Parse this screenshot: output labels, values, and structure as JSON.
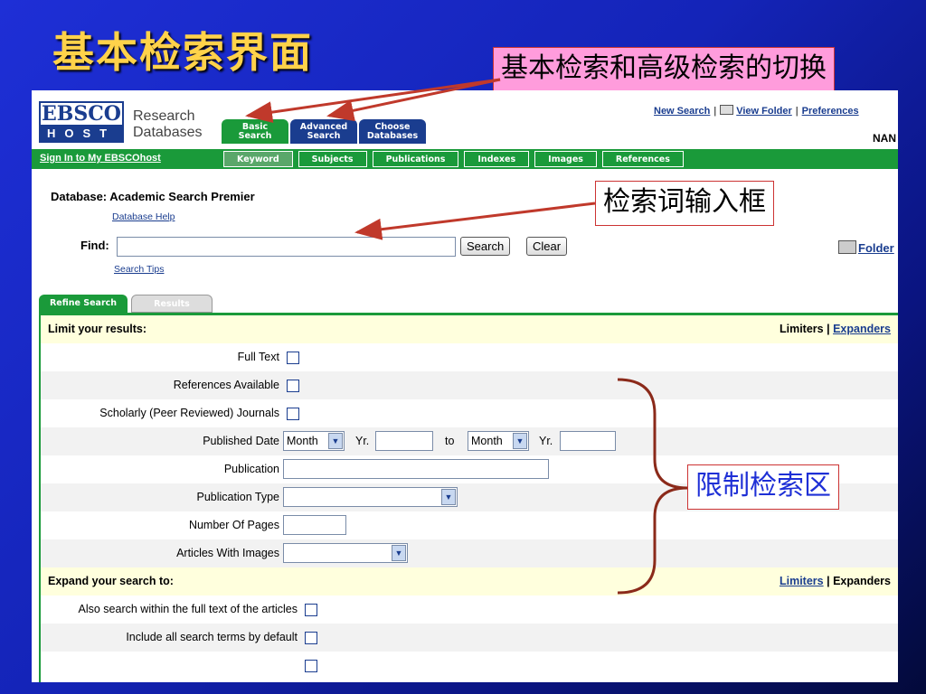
{
  "slide": {
    "title": "基本检索界面",
    "callout_top": "基本检索和高级检索的切换",
    "callout_find": "检索词输入框",
    "callout_limit": "限制检索区"
  },
  "logo": {
    "top": "EBSCO",
    "bottom": "HOST",
    "line1": "Research",
    "line2": "Databases"
  },
  "tabs": [
    {
      "line1": "Basic",
      "line2": "Search"
    },
    {
      "line1": "Advanced",
      "line2": "Search"
    },
    {
      "line1": "Choose",
      "line2": "Databases"
    }
  ],
  "toplinks": {
    "new_search": "New Search",
    "view_folder": "View Folder",
    "preferences": "Preferences",
    "sep": "|"
  },
  "user_name": "NAN",
  "navbar": {
    "signin": "Sign In to My EBSCOhost",
    "items": [
      "Keyword",
      "Subjects",
      "Publications",
      "Indexes",
      "Images",
      "References"
    ]
  },
  "database": {
    "label": "Database: Academic Search Premier",
    "help": "Database Help"
  },
  "find": {
    "label": "Find:",
    "value": "",
    "search_button": "Search",
    "clear_button": "Clear",
    "tips": "Search Tips",
    "folder": "Folder"
  },
  "result_tabs": {
    "refine": "Refine Search",
    "results": "Results"
  },
  "limit": {
    "heading": "Limit your results:",
    "right_plain": "Limiters",
    "sep": "|",
    "right_link": "Expanders",
    "full_text": "Full Text",
    "references_available": "References Available",
    "scholarly": "Scholarly (Peer Reviewed) Journals",
    "published_date": "Published Date",
    "month": "Month",
    "yr": "Yr.",
    "to": "to",
    "publication": "Publication",
    "publication_type": "Publication Type",
    "number_of_pages": "Number Of Pages",
    "articles_with_images": "Articles With Images"
  },
  "expand": {
    "heading": "Expand your search to:",
    "right_link": "Limiters",
    "sep": "|",
    "right_plain": "Expanders",
    "also_search": "Also search within the full text of the articles",
    "include_all": "Include all search terms by default"
  }
}
